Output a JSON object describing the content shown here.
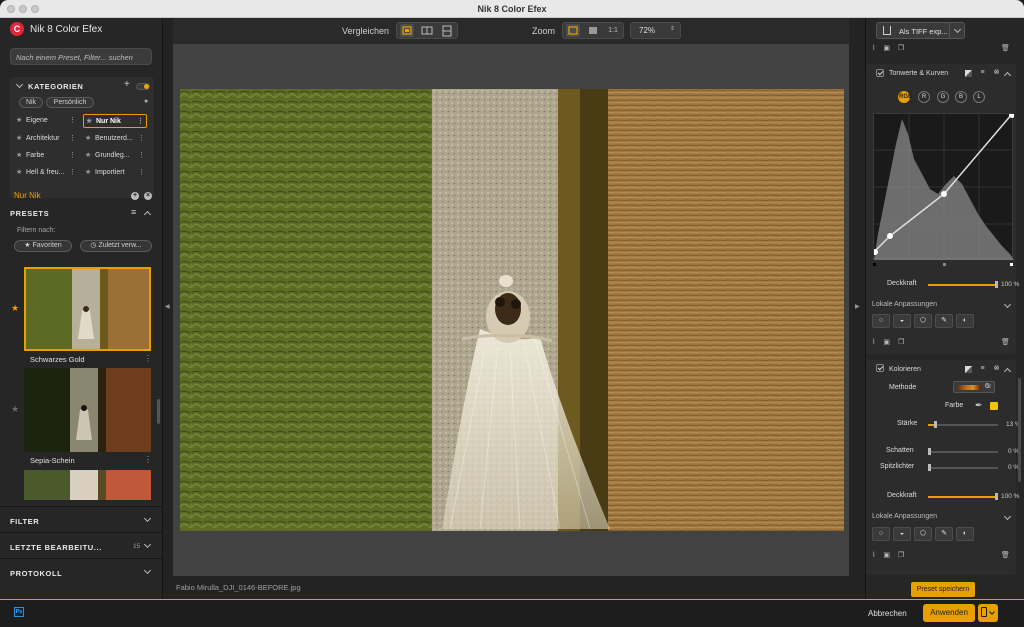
{
  "window": {
    "title": "Nik 8 Color Efex"
  },
  "app": {
    "name": "Nik 8 Color Efex",
    "logo_letter": "C"
  },
  "search": {
    "placeholder": "Nach einem Preset, Filter... suchen"
  },
  "categories": {
    "header": "KATEGORIEN",
    "tabs": [
      "Nik",
      "Persönlich"
    ],
    "items": [
      {
        "label": "Eigene",
        "selected": false
      },
      {
        "label": "Nur Nik",
        "selected": true
      },
      {
        "label": "Architektur",
        "selected": false
      },
      {
        "label": "Benutzerd...",
        "selected": false
      },
      {
        "label": "Farbe",
        "selected": false
      },
      {
        "label": "Grundleg...",
        "selected": false
      },
      {
        "label": "Hell & freu...",
        "selected": false
      },
      {
        "label": "Importiert",
        "selected": false
      }
    ],
    "active": "Nur Nik"
  },
  "presets": {
    "header": "PRESETS",
    "filter_label": "Filtern nach:",
    "filter_buttons": [
      "Favoriten",
      "Zuletzt verw..."
    ],
    "items": [
      {
        "label": "Schwarzes Gold",
        "starred": true
      },
      {
        "label": "Sepia-Schein",
        "starred": false
      }
    ]
  },
  "accordions": [
    {
      "label": "FILTER",
      "count": ""
    },
    {
      "label": "LETZTE BEARBEITU...",
      "count": "15"
    },
    {
      "label": "PROTOKOLL",
      "count": ""
    }
  ],
  "toolbar": {
    "compare_label": "Vergleichen",
    "zoom_label": "Zoom",
    "zoom_one": "1:1",
    "zoom_value": "72%"
  },
  "file": {
    "name": "Fabio Mirulla_DJI_0146-BEFORE.jpg"
  },
  "export": {
    "label": "Als TIFF exp..."
  },
  "tone_curves": {
    "title": "Tonwerte & Kurven",
    "channels": [
      "RGB",
      "R",
      "G",
      "B",
      "L"
    ],
    "active_channel": "RGB",
    "opacity_label": "Deckkraft",
    "opacity_value": "100 %",
    "opacity_fraction": 1.0,
    "local_label": "Lokale Anpassungen"
  },
  "colorize": {
    "title": "Kolorieren",
    "method_label": "Methode",
    "method_value": "6",
    "color_label": "Farbe",
    "color_hex": "#f5c400",
    "strength_label": "Stärke",
    "strength_value": "13 %",
    "strength_fraction": 0.13,
    "shadows_label": "Schatten",
    "shadows_value": "0 %",
    "highlights_label": "Spitzlichter",
    "highlights_value": "0 %",
    "opacity_label": "Deckkraft",
    "opacity_value": "100 %",
    "opacity_fraction": 1.0,
    "local_label": "Lokale Anpassungen"
  },
  "buttons": {
    "save_preset": "Preset speichern",
    "cancel": "Abbrechen",
    "apply": "Anwenden",
    "ps_badge": "Ps"
  },
  "colors": {
    "accent": "#e8a000",
    "panel": "#262626",
    "canvas": "#424242"
  },
  "icons": [
    "search-icon",
    "plus-icon",
    "menu-icon",
    "chevron-up-icon",
    "chevron-down-icon",
    "star-icon",
    "clock-icon",
    "compare-split-icon",
    "zoom-fit-icon",
    "export-icon",
    "checkbox-icon",
    "close-icon",
    "trash-icon",
    "copy-icon",
    "eyedropper-icon",
    "mask-icon"
  ]
}
